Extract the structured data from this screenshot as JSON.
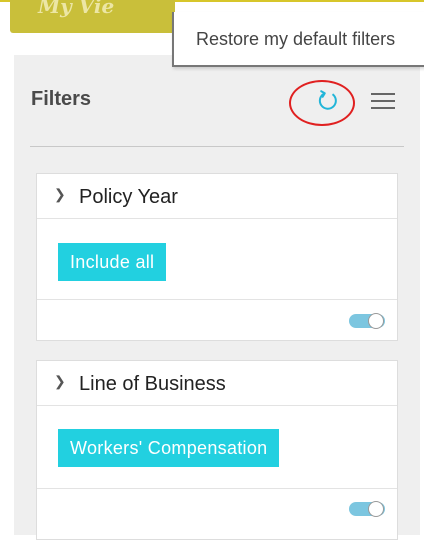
{
  "header": {
    "app_title_partial": "My Vie"
  },
  "tooltip": {
    "text": "Restore my default filters"
  },
  "filters_panel": {
    "title": "Filters",
    "restore_icon": "restore-icon",
    "menu_icon": "hamburger-menu-icon",
    "accent_color": "#22d0e0",
    "highlight_color": "#e02020",
    "cards": [
      {
        "title": "Policy Year",
        "selected_value": "Include all",
        "toggle_on": true
      },
      {
        "title": "Line of Business",
        "selected_value": "Workers' Compensation",
        "toggle_on": true
      }
    ]
  }
}
